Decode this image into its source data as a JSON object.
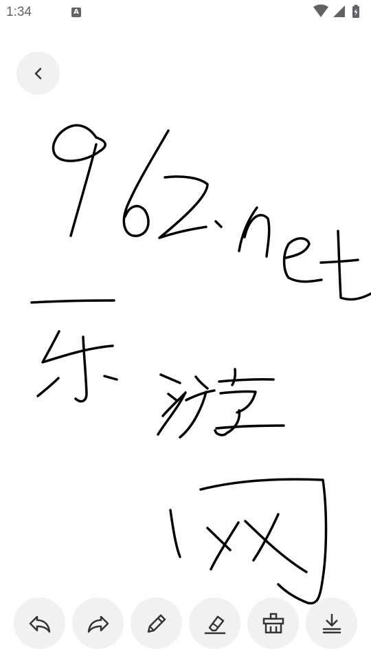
{
  "status_bar": {
    "time": "1:34",
    "notification_icon": "a-letter-icon",
    "icons": [
      "wifi-icon",
      "signal-icon",
      "battery-charging-icon"
    ]
  },
  "header": {
    "back_icon": "chevron-left-icon"
  },
  "drawing": {
    "description_icon": "handwriting-strokes",
    "stroke_color": "#000000"
  },
  "toolbar": {
    "buttons": [
      {
        "icon": "undo-icon"
      },
      {
        "icon": "redo-icon"
      },
      {
        "icon": "pencil-icon"
      },
      {
        "icon": "eraser-icon"
      },
      {
        "icon": "clear-basket-icon"
      },
      {
        "icon": "download-icon"
      }
    ],
    "button_bg": "#f1f1f1",
    "icon_color": "#333333"
  }
}
